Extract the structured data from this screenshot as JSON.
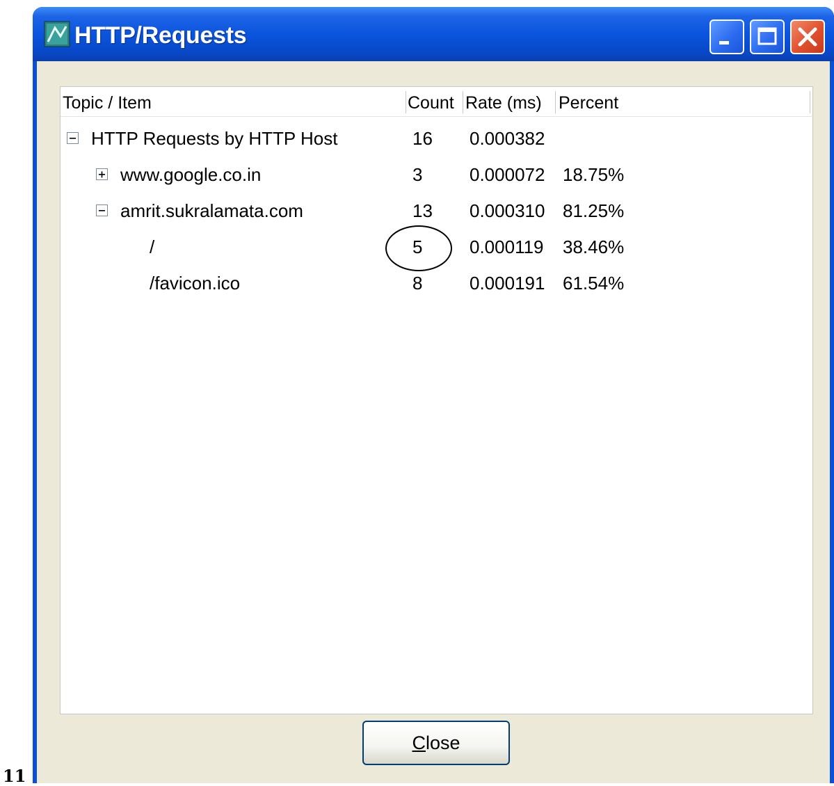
{
  "page_label": "11",
  "window": {
    "title": "HTTP/Requests",
    "buttons": [
      "minimize",
      "maximize",
      "close"
    ]
  },
  "listview": {
    "columns": [
      "Topic / Item",
      "Count",
      "Rate (ms)",
      "Percent"
    ],
    "rows": [
      {
        "item": "HTTP Requests by HTTP Host",
        "count": "16",
        "rate": "0.000382",
        "percent": "",
        "expander": "collapse"
      },
      {
        "item": "www.google.co.in",
        "count": "3",
        "rate": "0.000072",
        "percent": "18.75%",
        "expander": "expand"
      },
      {
        "item": "amrit.sukralamata.com",
        "count": "13",
        "rate": "0.000310",
        "percent": "81.25%",
        "expander": "collapse"
      },
      {
        "item": "/",
        "count": "5",
        "rate": "0.000119",
        "percent": "38.46%",
        "expander": ""
      },
      {
        "item": "/favicon.ico",
        "count": "8",
        "rate": "0.000191",
        "percent": "61.54%",
        "expander": ""
      }
    ]
  },
  "close_button": {
    "mnemonic": "C",
    "rest": "lose"
  }
}
